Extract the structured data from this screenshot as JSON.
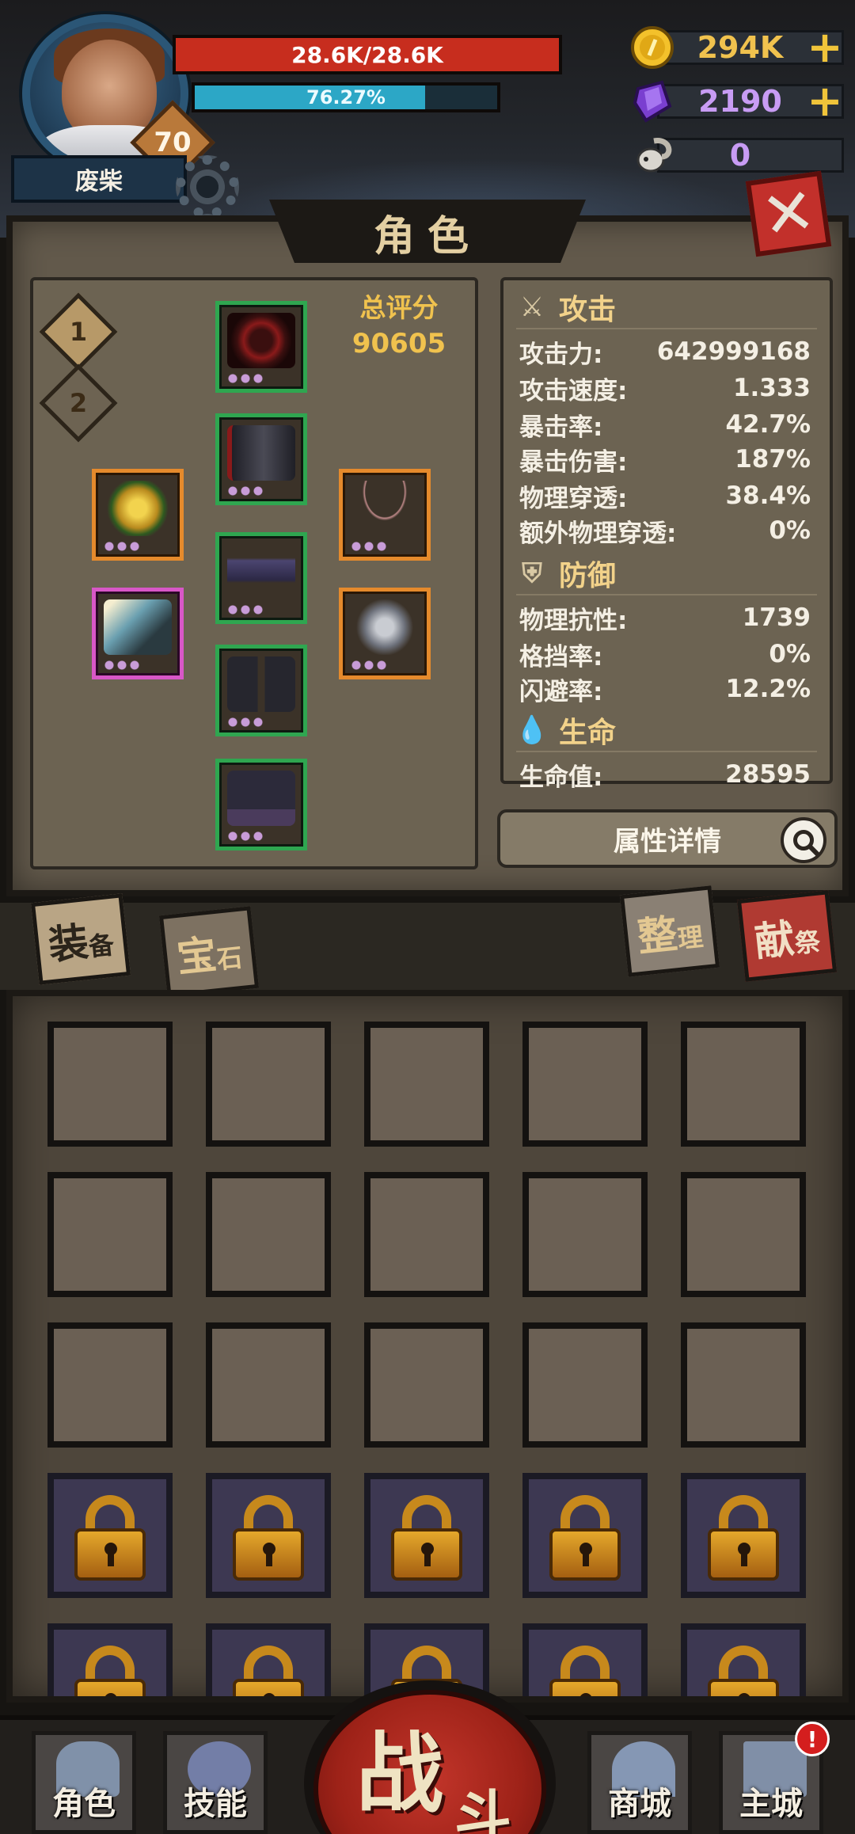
{
  "player": {
    "name": "废柴",
    "level": "70",
    "hp_text": "28.6K/28.6K",
    "hp_fraction": 1.0,
    "xp_text": "76.27%",
    "xp_fraction": 0.7627
  },
  "currencies": {
    "gold": "294K",
    "crystal": "2190",
    "skull": "0"
  },
  "panel": {
    "title": "角色",
    "total_score_label": "总评分",
    "total_score": "90605",
    "loadout_tabs": [
      "1",
      "2"
    ]
  },
  "stats": {
    "attack": {
      "title": "攻击",
      "rows": [
        {
          "label": "攻击力:",
          "value": "642999168"
        },
        {
          "label": "攻击速度:",
          "value": "1.333"
        },
        {
          "label": "暴击率:",
          "value": "42.7%"
        },
        {
          "label": "暴击伤害:",
          "value": "187%"
        },
        {
          "label": "物理穿透:",
          "value": "38.4%"
        },
        {
          "label": "额外物理穿透:",
          "value": "0%"
        }
      ]
    },
    "defense": {
      "title": "防御",
      "rows": [
        {
          "label": "物理抗性:",
          "value": "1739"
        },
        {
          "label": "格挡率:",
          "value": "0%"
        },
        {
          "label": "闪避率:",
          "value": "12.2%"
        }
      ]
    },
    "life": {
      "title": "生命",
      "rows": [
        {
          "label": "生命值:",
          "value": "28595"
        }
      ]
    },
    "detail_button": "属性详情"
  },
  "inventory": {
    "tabs": [
      {
        "big": "装",
        "small": "备"
      },
      {
        "big": "宝",
        "small": "石"
      },
      {
        "big": "整",
        "small": "理"
      },
      {
        "big": "献",
        "small": "祭"
      }
    ]
  },
  "nav": {
    "character": "角色",
    "skills": "技能",
    "fight_big": "战",
    "fight_small": "斗",
    "shop": "商城",
    "main_city": "主城",
    "main_city_badge": "!"
  },
  "colors": {
    "gold_text": "#f0c24e",
    "hp_fill": "#c72d1e",
    "xp_fill": "#2ca7c6",
    "common_slot": "#2fa650",
    "rare_slot": "#e58a2c",
    "epic_slot": "#d857c7"
  }
}
